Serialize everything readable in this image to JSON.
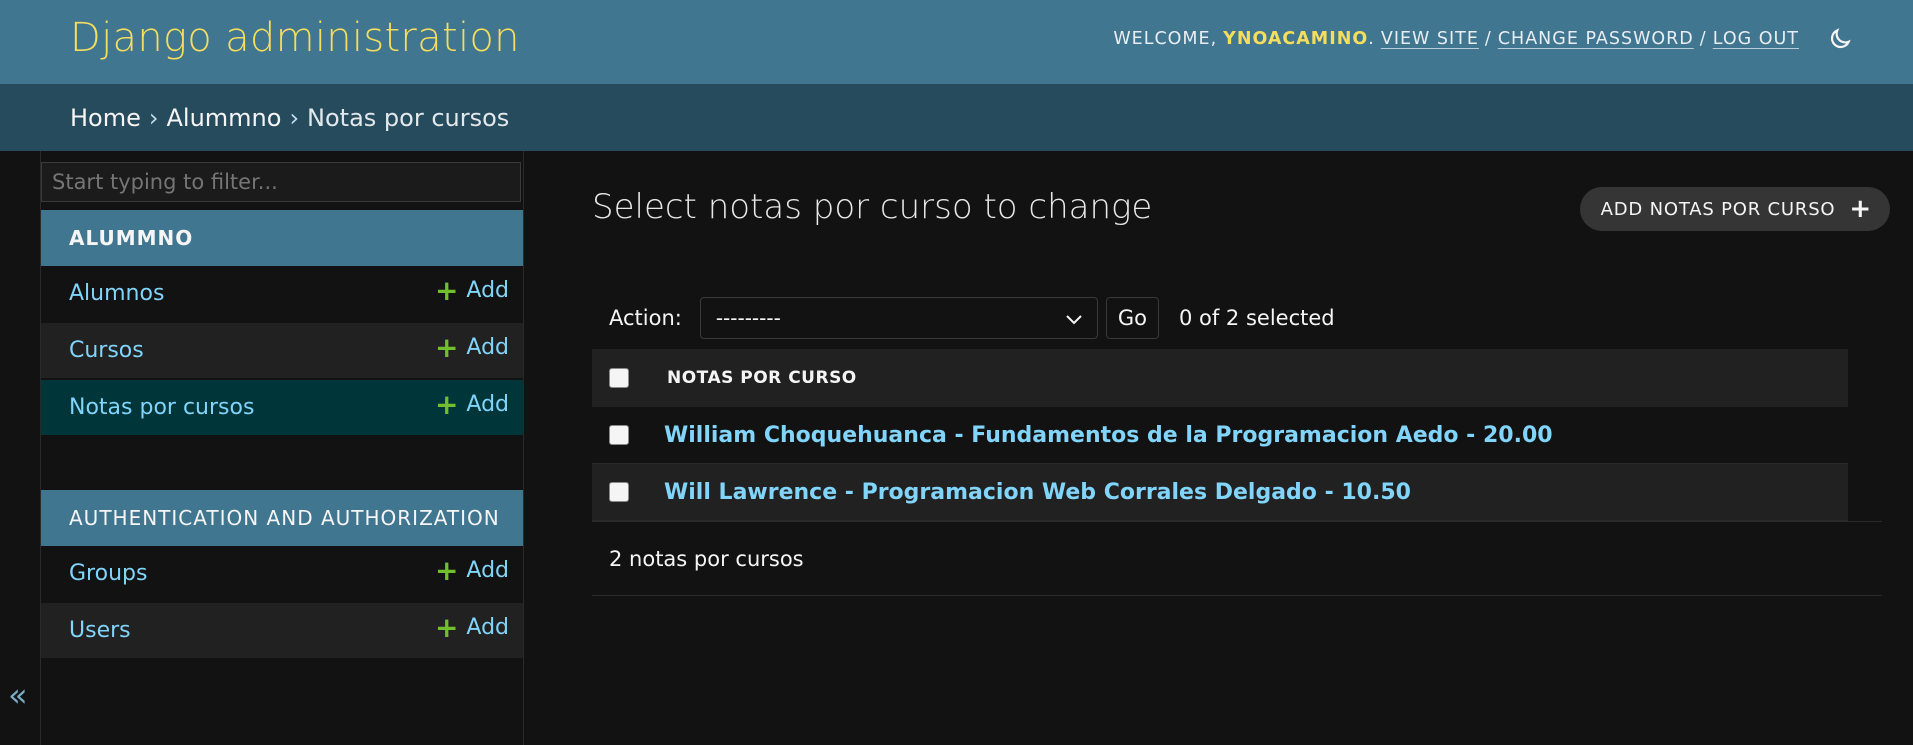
{
  "header": {
    "brand": "Django administration",
    "welcome": "WELCOME,",
    "username": "YNOACAMINO",
    "period": ".",
    "view_site": "VIEW SITE",
    "sep": "/",
    "change_password": "CHANGE PASSWORD",
    "log_out": "LOG OUT",
    "theme_icon": "moon-icon"
  },
  "breadcrumbs": {
    "home": "Home",
    "sep": "›",
    "app": "Alummno",
    "current": "Notas por cursos"
  },
  "sidebar": {
    "filter_placeholder": "Start typing to filter...",
    "toggle": "«",
    "apps": [
      {
        "caption": "ALUMMNO",
        "models": [
          {
            "name": "Alumnos",
            "add": "Add"
          },
          {
            "name": "Cursos",
            "add": "Add"
          },
          {
            "name": "Notas por cursos",
            "add": "Add",
            "selected": true
          }
        ]
      },
      {
        "caption": "AUTHENTICATION AND AUTHORIZATION",
        "models": [
          {
            "name": "Groups",
            "add": "Add"
          },
          {
            "name": "Users",
            "add": "Add"
          }
        ]
      }
    ]
  },
  "main": {
    "title": "Select notas por curso to change",
    "add_button": "ADD NOTAS POR CURSO",
    "action_label": "Action:",
    "action_value": "---------",
    "go": "Go",
    "selected_count": "0 of 2 selected",
    "column": "NOTAS POR CURSO",
    "rows": [
      "William Choquehuanca - Fundamentos de la Programacion Aedo - 20.00",
      "Will Lawrence - Programacion Web Corrales Delgado - 10.50"
    ],
    "paginator": "2 notas por cursos"
  },
  "colors": {
    "header_bg": "#417690",
    "breadcrumb_bg": "#264b5d",
    "brand": "#f5dd5d",
    "link": "#81d4fa",
    "add_plus": "#70bf2b"
  }
}
